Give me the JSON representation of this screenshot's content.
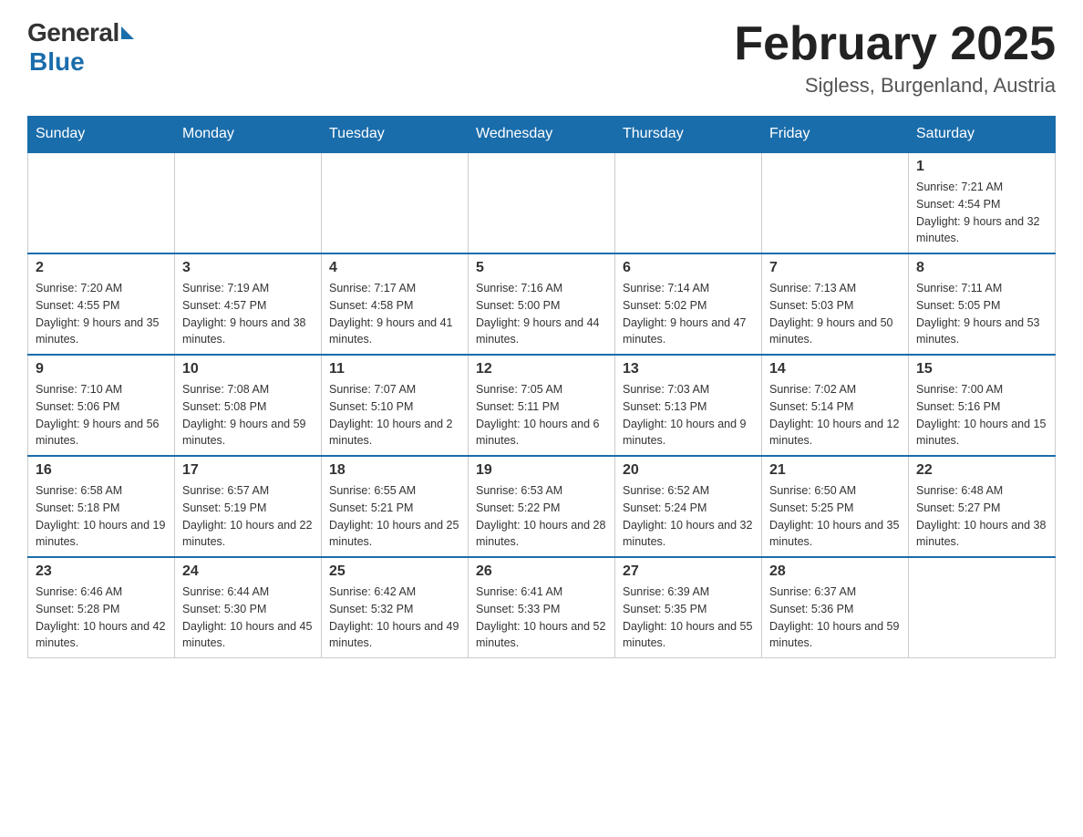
{
  "logo": {
    "general": "General",
    "arrow": "▶",
    "blue": "Blue"
  },
  "header": {
    "month_year": "February 2025",
    "location": "Sigless, Burgenland, Austria"
  },
  "weekdays": [
    "Sunday",
    "Monday",
    "Tuesday",
    "Wednesday",
    "Thursday",
    "Friday",
    "Saturday"
  ],
  "weeks": [
    [
      {
        "day": "",
        "sunrise": "",
        "sunset": "",
        "daylight": ""
      },
      {
        "day": "",
        "sunrise": "",
        "sunset": "",
        "daylight": ""
      },
      {
        "day": "",
        "sunrise": "",
        "sunset": "",
        "daylight": ""
      },
      {
        "day": "",
        "sunrise": "",
        "sunset": "",
        "daylight": ""
      },
      {
        "day": "",
        "sunrise": "",
        "sunset": "",
        "daylight": ""
      },
      {
        "day": "",
        "sunrise": "",
        "sunset": "",
        "daylight": ""
      },
      {
        "day": "1",
        "sunrise": "Sunrise: 7:21 AM",
        "sunset": "Sunset: 4:54 PM",
        "daylight": "Daylight: 9 hours and 32 minutes."
      }
    ],
    [
      {
        "day": "2",
        "sunrise": "Sunrise: 7:20 AM",
        "sunset": "Sunset: 4:55 PM",
        "daylight": "Daylight: 9 hours and 35 minutes."
      },
      {
        "day": "3",
        "sunrise": "Sunrise: 7:19 AM",
        "sunset": "Sunset: 4:57 PM",
        "daylight": "Daylight: 9 hours and 38 minutes."
      },
      {
        "day": "4",
        "sunrise": "Sunrise: 7:17 AM",
        "sunset": "Sunset: 4:58 PM",
        "daylight": "Daylight: 9 hours and 41 minutes."
      },
      {
        "day": "5",
        "sunrise": "Sunrise: 7:16 AM",
        "sunset": "Sunset: 5:00 PM",
        "daylight": "Daylight: 9 hours and 44 minutes."
      },
      {
        "day": "6",
        "sunrise": "Sunrise: 7:14 AM",
        "sunset": "Sunset: 5:02 PM",
        "daylight": "Daylight: 9 hours and 47 minutes."
      },
      {
        "day": "7",
        "sunrise": "Sunrise: 7:13 AM",
        "sunset": "Sunset: 5:03 PM",
        "daylight": "Daylight: 9 hours and 50 minutes."
      },
      {
        "day": "8",
        "sunrise": "Sunrise: 7:11 AM",
        "sunset": "Sunset: 5:05 PM",
        "daylight": "Daylight: 9 hours and 53 minutes."
      }
    ],
    [
      {
        "day": "9",
        "sunrise": "Sunrise: 7:10 AM",
        "sunset": "Sunset: 5:06 PM",
        "daylight": "Daylight: 9 hours and 56 minutes."
      },
      {
        "day": "10",
        "sunrise": "Sunrise: 7:08 AM",
        "sunset": "Sunset: 5:08 PM",
        "daylight": "Daylight: 9 hours and 59 minutes."
      },
      {
        "day": "11",
        "sunrise": "Sunrise: 7:07 AM",
        "sunset": "Sunset: 5:10 PM",
        "daylight": "Daylight: 10 hours and 2 minutes."
      },
      {
        "day": "12",
        "sunrise": "Sunrise: 7:05 AM",
        "sunset": "Sunset: 5:11 PM",
        "daylight": "Daylight: 10 hours and 6 minutes."
      },
      {
        "day": "13",
        "sunrise": "Sunrise: 7:03 AM",
        "sunset": "Sunset: 5:13 PM",
        "daylight": "Daylight: 10 hours and 9 minutes."
      },
      {
        "day": "14",
        "sunrise": "Sunrise: 7:02 AM",
        "sunset": "Sunset: 5:14 PM",
        "daylight": "Daylight: 10 hours and 12 minutes."
      },
      {
        "day": "15",
        "sunrise": "Sunrise: 7:00 AM",
        "sunset": "Sunset: 5:16 PM",
        "daylight": "Daylight: 10 hours and 15 minutes."
      }
    ],
    [
      {
        "day": "16",
        "sunrise": "Sunrise: 6:58 AM",
        "sunset": "Sunset: 5:18 PM",
        "daylight": "Daylight: 10 hours and 19 minutes."
      },
      {
        "day": "17",
        "sunrise": "Sunrise: 6:57 AM",
        "sunset": "Sunset: 5:19 PM",
        "daylight": "Daylight: 10 hours and 22 minutes."
      },
      {
        "day": "18",
        "sunrise": "Sunrise: 6:55 AM",
        "sunset": "Sunset: 5:21 PM",
        "daylight": "Daylight: 10 hours and 25 minutes."
      },
      {
        "day": "19",
        "sunrise": "Sunrise: 6:53 AM",
        "sunset": "Sunset: 5:22 PM",
        "daylight": "Daylight: 10 hours and 28 minutes."
      },
      {
        "day": "20",
        "sunrise": "Sunrise: 6:52 AM",
        "sunset": "Sunset: 5:24 PM",
        "daylight": "Daylight: 10 hours and 32 minutes."
      },
      {
        "day": "21",
        "sunrise": "Sunrise: 6:50 AM",
        "sunset": "Sunset: 5:25 PM",
        "daylight": "Daylight: 10 hours and 35 minutes."
      },
      {
        "day": "22",
        "sunrise": "Sunrise: 6:48 AM",
        "sunset": "Sunset: 5:27 PM",
        "daylight": "Daylight: 10 hours and 38 minutes."
      }
    ],
    [
      {
        "day": "23",
        "sunrise": "Sunrise: 6:46 AM",
        "sunset": "Sunset: 5:28 PM",
        "daylight": "Daylight: 10 hours and 42 minutes."
      },
      {
        "day": "24",
        "sunrise": "Sunrise: 6:44 AM",
        "sunset": "Sunset: 5:30 PM",
        "daylight": "Daylight: 10 hours and 45 minutes."
      },
      {
        "day": "25",
        "sunrise": "Sunrise: 6:42 AM",
        "sunset": "Sunset: 5:32 PM",
        "daylight": "Daylight: 10 hours and 49 minutes."
      },
      {
        "day": "26",
        "sunrise": "Sunrise: 6:41 AM",
        "sunset": "Sunset: 5:33 PM",
        "daylight": "Daylight: 10 hours and 52 minutes."
      },
      {
        "day": "27",
        "sunrise": "Sunrise: 6:39 AM",
        "sunset": "Sunset: 5:35 PM",
        "daylight": "Daylight: 10 hours and 55 minutes."
      },
      {
        "day": "28",
        "sunrise": "Sunrise: 6:37 AM",
        "sunset": "Sunset: 5:36 PM",
        "daylight": "Daylight: 10 hours and 59 minutes."
      },
      {
        "day": "",
        "sunrise": "",
        "sunset": "",
        "daylight": ""
      }
    ]
  ]
}
